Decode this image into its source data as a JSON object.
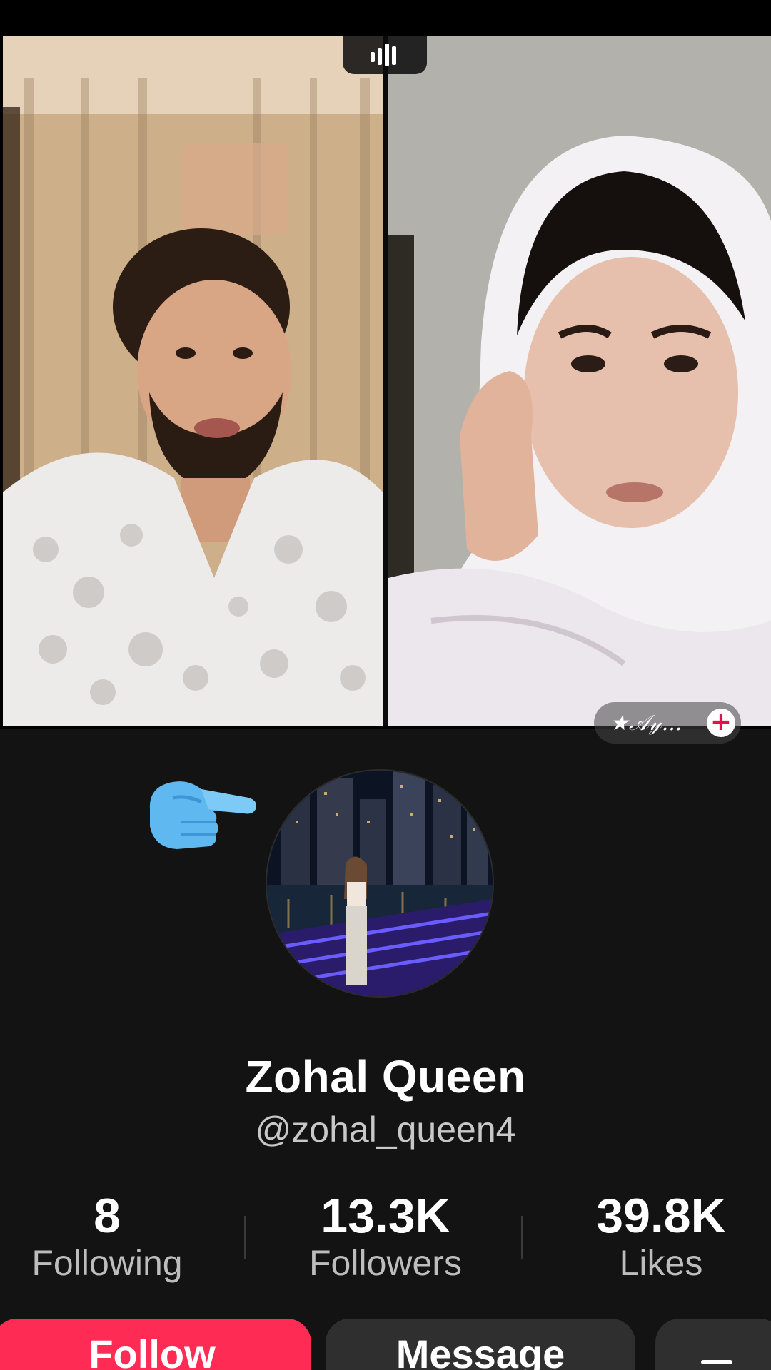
{
  "live": {
    "guest_tag": "★𝒜𝓎...",
    "guest_follow_icon": "plus-icon",
    "audio_icon": "audio-level-icon"
  },
  "profile": {
    "display_name": "Zohal Queen",
    "username": "@zohal_queen4",
    "pointer_icon": "pointing-hand-emoji",
    "stats": [
      {
        "value": "8",
        "label": "Following"
      },
      {
        "value": "13.3K",
        "label": "Followers"
      },
      {
        "value": "39.8K",
        "label": "Likes"
      }
    ]
  },
  "actions": {
    "follow_label": "Follow",
    "message_label": "Message",
    "more_icon": "chevron-down-icon"
  },
  "colors": {
    "follow_button": "#fe2c55",
    "secondary_button": "#2f2f2f",
    "background": "#131313"
  }
}
